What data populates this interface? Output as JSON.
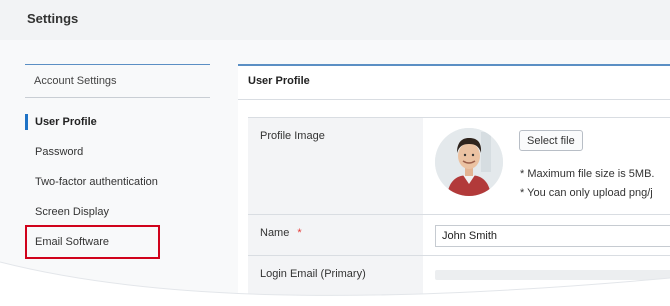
{
  "page": {
    "title": "Settings"
  },
  "sidebar": {
    "header": "Account Settings",
    "items": [
      {
        "label": "User Profile",
        "active": true
      },
      {
        "label": "Password"
      },
      {
        "label": "Two-factor authentication"
      },
      {
        "label": "Screen Display"
      },
      {
        "label": "Email Software",
        "highlighted": true
      }
    ]
  },
  "main": {
    "title": "User Profile",
    "profile_image": {
      "label": "Profile Image",
      "button": "Select file",
      "notes": [
        "* Maximum file size is 5MB.",
        "* You can only upload png/j"
      ]
    },
    "name": {
      "label": "Name",
      "required_mark": "*",
      "value": "John Smith"
    },
    "login_email": {
      "label": "Login Email (Primary)"
    }
  },
  "colors": {
    "accent": "#1f73c6",
    "highlight": "#d0021b",
    "required": "#e53935"
  }
}
